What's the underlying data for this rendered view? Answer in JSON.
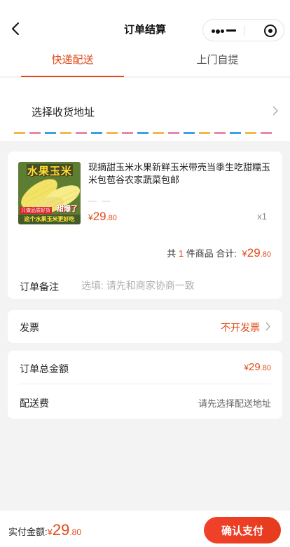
{
  "header": {
    "title": "订单结算"
  },
  "tabs": [
    {
      "label": "快递配送",
      "active": true
    },
    {
      "label": "上门自提",
      "active": false
    }
  ],
  "address": {
    "placeholder": "选择收货地址"
  },
  "product": {
    "image_banner": "水果玉米",
    "image_tag1": "只做品质好货",
    "image_tag2": "甜爆了",
    "image_tag3": "这个水果玉米更好吃",
    "title": "现摘甜玉米水果新鲜玉米带壳当季生吃甜糯玉米包苞谷农家蔬菜包邮",
    "price_symbol": "¥",
    "price_int": "29",
    "price_dec": ".80",
    "quantity": "x1"
  },
  "summary": {
    "prefix": "共",
    "count": "1",
    "suffix": "件商品 合计:",
    "symbol": "¥",
    "total_int": "29",
    "total_dec": ".80"
  },
  "note": {
    "label": "订单备注",
    "placeholder": "选填: 请先和商家协商一致"
  },
  "invoice": {
    "label": "发票",
    "value": "不开发票"
  },
  "totals": {
    "order_total_label": "订单总金额",
    "order_total_symbol": "¥",
    "order_total_int": "29",
    "order_total_dec": ".80",
    "shipping_label": "配送费",
    "shipping_hint": "请先选择配送地址"
  },
  "footer": {
    "paid_label": "实付金额:",
    "symbol": "¥",
    "paid_int": "29",
    "paid_dec": ".80",
    "confirm_label": "确认支付"
  },
  "colors": {
    "accent": "#e24a1b",
    "button": "#ef3f24",
    "background": "#f3f3f3"
  }
}
